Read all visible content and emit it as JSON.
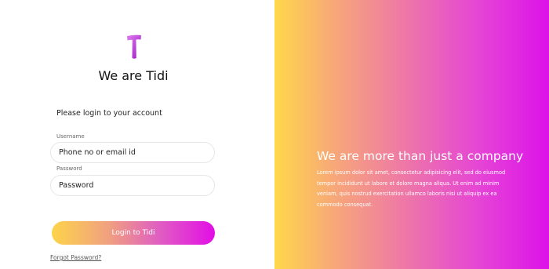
{
  "brand": {
    "title": "We are Tidi",
    "logo_icon": "tidi-logo-icon",
    "logo_colors": [
      "#e07af0",
      "#9a1fc0"
    ]
  },
  "form": {
    "prompt": "Please login to your account",
    "username_label": "Username",
    "username_placeholder": "Phone no or email id",
    "password_label": "Password",
    "password_placeholder": "Password",
    "login_label": "Login to Tidi",
    "forgot_label": "Forgot Password?"
  },
  "hero": {
    "title": "We are more than just a company",
    "body": "Lorem ipsum dolor sit amet, consectetur adipisicing elit, sed do eiusmod tempor incididunt ut labore et dolore magna aliqua. Ut enim ad minim veniam, quis nostrud exercitation ullamco laboris nisi ut aliquip ex ea commodo consequat."
  },
  "colors": {
    "gradient_start": "#ffd84a",
    "gradient_end": "#dc12e8"
  }
}
